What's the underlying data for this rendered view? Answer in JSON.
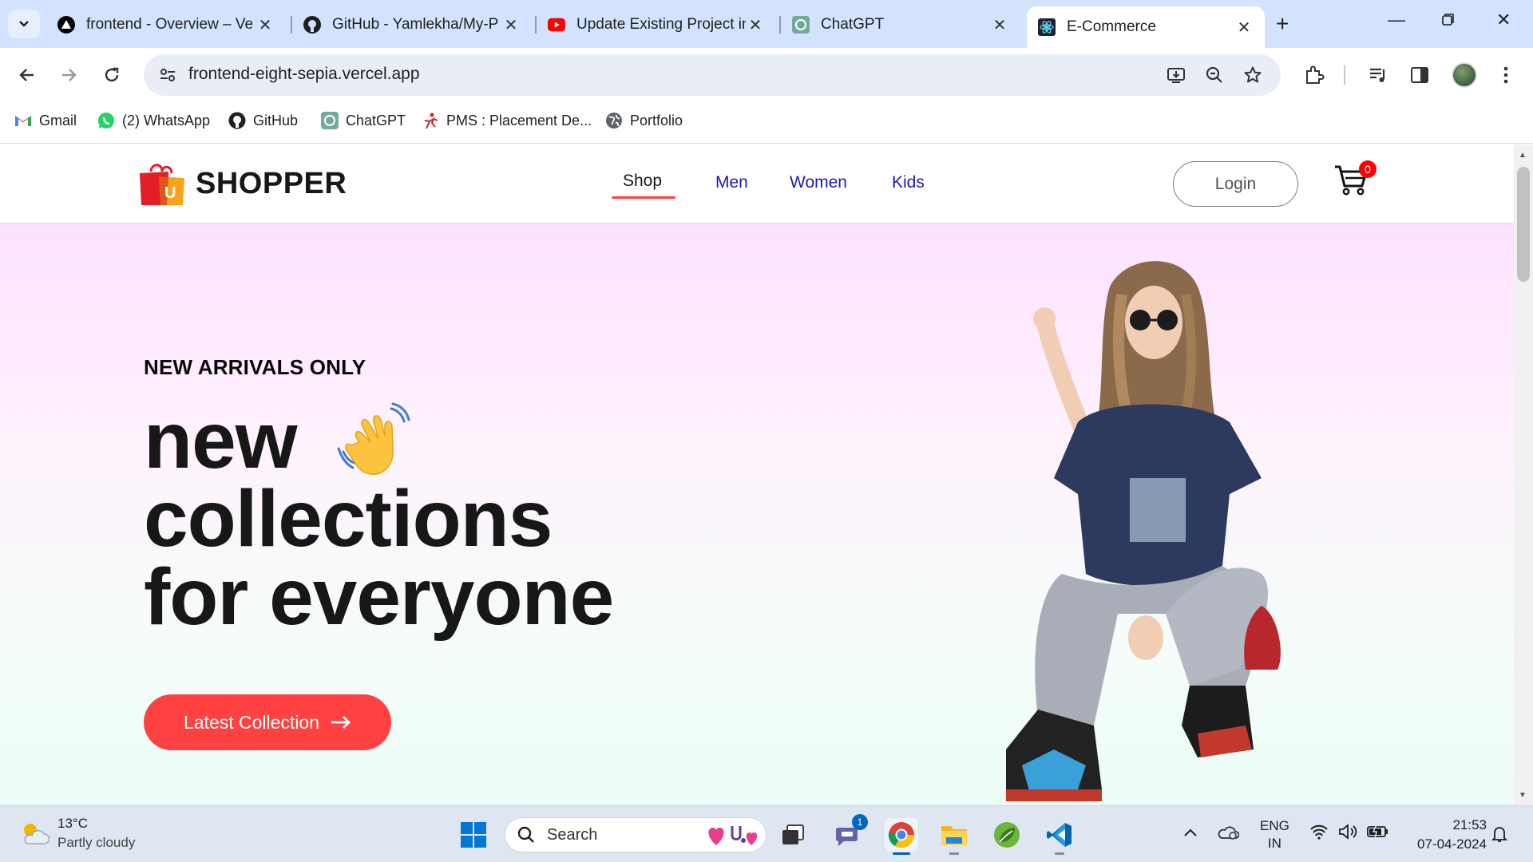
{
  "browser": {
    "tabs": [
      {
        "title": "frontend - Overview – Ve",
        "icon": "vercel-icon"
      },
      {
        "title": "GitHub - Yamlekha/My-P",
        "icon": "github-icon"
      },
      {
        "title": "Update Existing Project in",
        "icon": "youtube-icon"
      },
      {
        "title": "ChatGPT",
        "icon": "chatgpt-icon"
      },
      {
        "title": "E-Commerce",
        "icon": "react-icon",
        "active": true
      }
    ],
    "url": "frontend-eight-sepia.vercel.app",
    "bookmarks": [
      {
        "label": "Gmail",
        "icon": "gmail-icon"
      },
      {
        "label": "(2) WhatsApp",
        "icon": "whatsapp-icon"
      },
      {
        "label": "GitHub",
        "icon": "github-icon"
      },
      {
        "label": "ChatGPT",
        "icon": "chatgpt-icon"
      },
      {
        "label": "PMS : Placement De...",
        "icon": "pms-icon"
      },
      {
        "label": "Portfolio",
        "icon": "globe-icon"
      }
    ]
  },
  "site": {
    "brand": "SHOPPER",
    "logo_letter": "U",
    "menu": [
      {
        "label": "Shop",
        "active": true
      },
      {
        "label": "Men"
      },
      {
        "label": "Women"
      },
      {
        "label": "Kids"
      }
    ],
    "login_label": "Login",
    "cart_count": "0",
    "hero": {
      "eyebrow": "NEW ARRIVALS ONLY",
      "line1": "new",
      "line2": "collections",
      "line3": "for everyone",
      "cta_label": "Latest Collection"
    },
    "colors": {
      "accent": "#ff4141",
      "menu_link": "#1b1bb3",
      "hero_top": "#fde1ff",
      "hero_bottom": "#ecfdf6"
    }
  },
  "taskbar": {
    "weather_temp": "13°C",
    "weather_cond": "Partly cloudy",
    "search_placeholder": "Search",
    "lang_line1": "ENG",
    "lang_line2": "IN",
    "time": "21:53",
    "date": "07-04-2024",
    "teams_badge": "1"
  }
}
